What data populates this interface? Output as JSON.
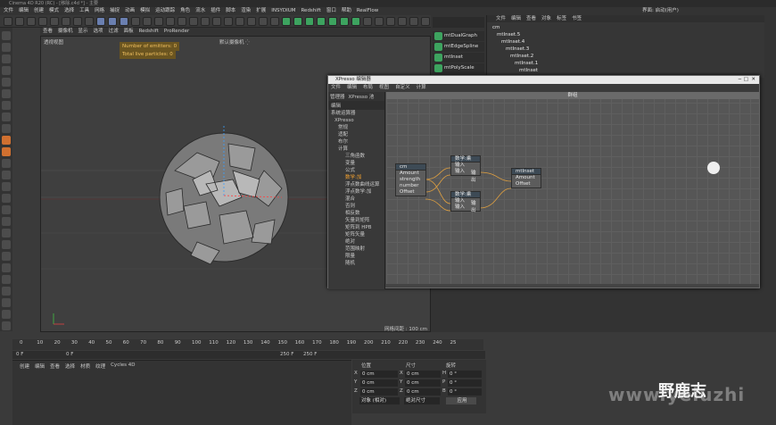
{
  "window": {
    "title": "Cinema 4D R20 (RC) - [移除.c4d *] - 主要"
  },
  "menu": [
    "文件",
    "编辑",
    "创建",
    "模式",
    "选择",
    "工具",
    "网格",
    "捕捉",
    "动画",
    "模拟",
    "运动跟踪",
    "角色",
    "流水",
    "插件",
    "脚本",
    "渲染",
    "扩展",
    "INSYDIUM",
    "Redshift",
    "窗口",
    "帮助",
    "RealFlow"
  ],
  "layout_label": "界面: 启动(用户)",
  "viewport": {
    "menu": [
      "查看",
      "摄像机",
      "显示",
      "选项",
      "过滤",
      "面板",
      "Redshift",
      "ProRender"
    ],
    "label": "透视视图",
    "camera": "默认摄像机 ⁛",
    "hud": [
      "Number of emitters: 0",
      "Total live particles: 0"
    ],
    "grid_info": "网格间距 : 100 cm"
  },
  "object_manager": {
    "menu": [
      "文件",
      "编辑",
      "查看",
      "对象",
      "标签",
      "书签"
    ],
    "items": [
      "cm",
      "mtInset.5",
      "mtInset.4",
      "mtInset.3",
      "mtInset.2",
      "mtInset.1",
      "mtInset"
    ]
  },
  "node_buttons": [
    "mtDualGraph",
    "mtEdgeSpline",
    "mtInset",
    "mtPolyScale"
  ],
  "xpresso": {
    "title": "XPresso 编辑器",
    "menu": [
      "文件",
      "编辑",
      "布局",
      "视图",
      "自定义",
      "计算"
    ],
    "left_tabs": [
      "管理器",
      "XPresso 池"
    ],
    "left_header": "编辑",
    "tree": [
      "系统运算器",
      "XPresso",
      "常规",
      "适配",
      "布尔",
      "计算",
      "三角函数",
      "变量",
      "公式",
      "数学:加",
      "浮点数曲线运算",
      "浮点数学:加",
      "混合",
      "否则",
      "相反数",
      "矢量到矩阵",
      "矩阵到 HPB",
      "矩阵矢量",
      "绝对",
      "范围映射",
      "限量",
      "随机"
    ],
    "group_label": "群组",
    "nodes": {
      "cm": {
        "title": "cm",
        "ports": [
          "Amount",
          "strength",
          "number",
          "Offset"
        ]
      },
      "math1": {
        "title": "数学:乘",
        "ports": [
          "输入",
          "输入"
        ],
        "out": "输出"
      },
      "math2": {
        "title": "数学:乘",
        "ports": [
          "输入",
          "输入"
        ],
        "out": "输出"
      },
      "mtinset": {
        "title": "mtInset",
        "ports": [
          "Amount",
          "Offset"
        ]
      }
    }
  },
  "timeline": {
    "ticks": [
      "0",
      "10",
      "20",
      "30",
      "40",
      "50",
      "60",
      "70",
      "80",
      "90",
      "100",
      "110",
      "120",
      "130",
      "140",
      "150",
      "160",
      "170",
      "180",
      "190",
      "200",
      "210",
      "220",
      "230",
      "240",
      "25"
    ],
    "current": "0 F",
    "start": "0 F",
    "end": "250 F",
    "end2": "250 F"
  },
  "material_manager": {
    "menu": [
      "创建",
      "编辑",
      "查看",
      "选择",
      "材质",
      "纹理",
      "Cycles 4D"
    ]
  },
  "attributes": {
    "headers": [
      "位置",
      "尺寸",
      "旋转"
    ],
    "rows": [
      {
        "axis": "X",
        "pos": "0 cm",
        "size": "0 cm",
        "rl": "H",
        "rot": "0 °"
      },
      {
        "axis": "Y",
        "pos": "0 cm",
        "size": "0 cm",
        "rl": "P",
        "rot": "0 °"
      },
      {
        "axis": "Z",
        "pos": "0 cm",
        "size": "0 cm",
        "rl": "B",
        "rot": "0 °"
      }
    ],
    "mode": "对象 (相对)",
    "size_mode": "绝对尺寸",
    "apply": "应用"
  },
  "watermark": {
    "text": "野鹿志",
    "faint": "www.yeluzhi"
  }
}
